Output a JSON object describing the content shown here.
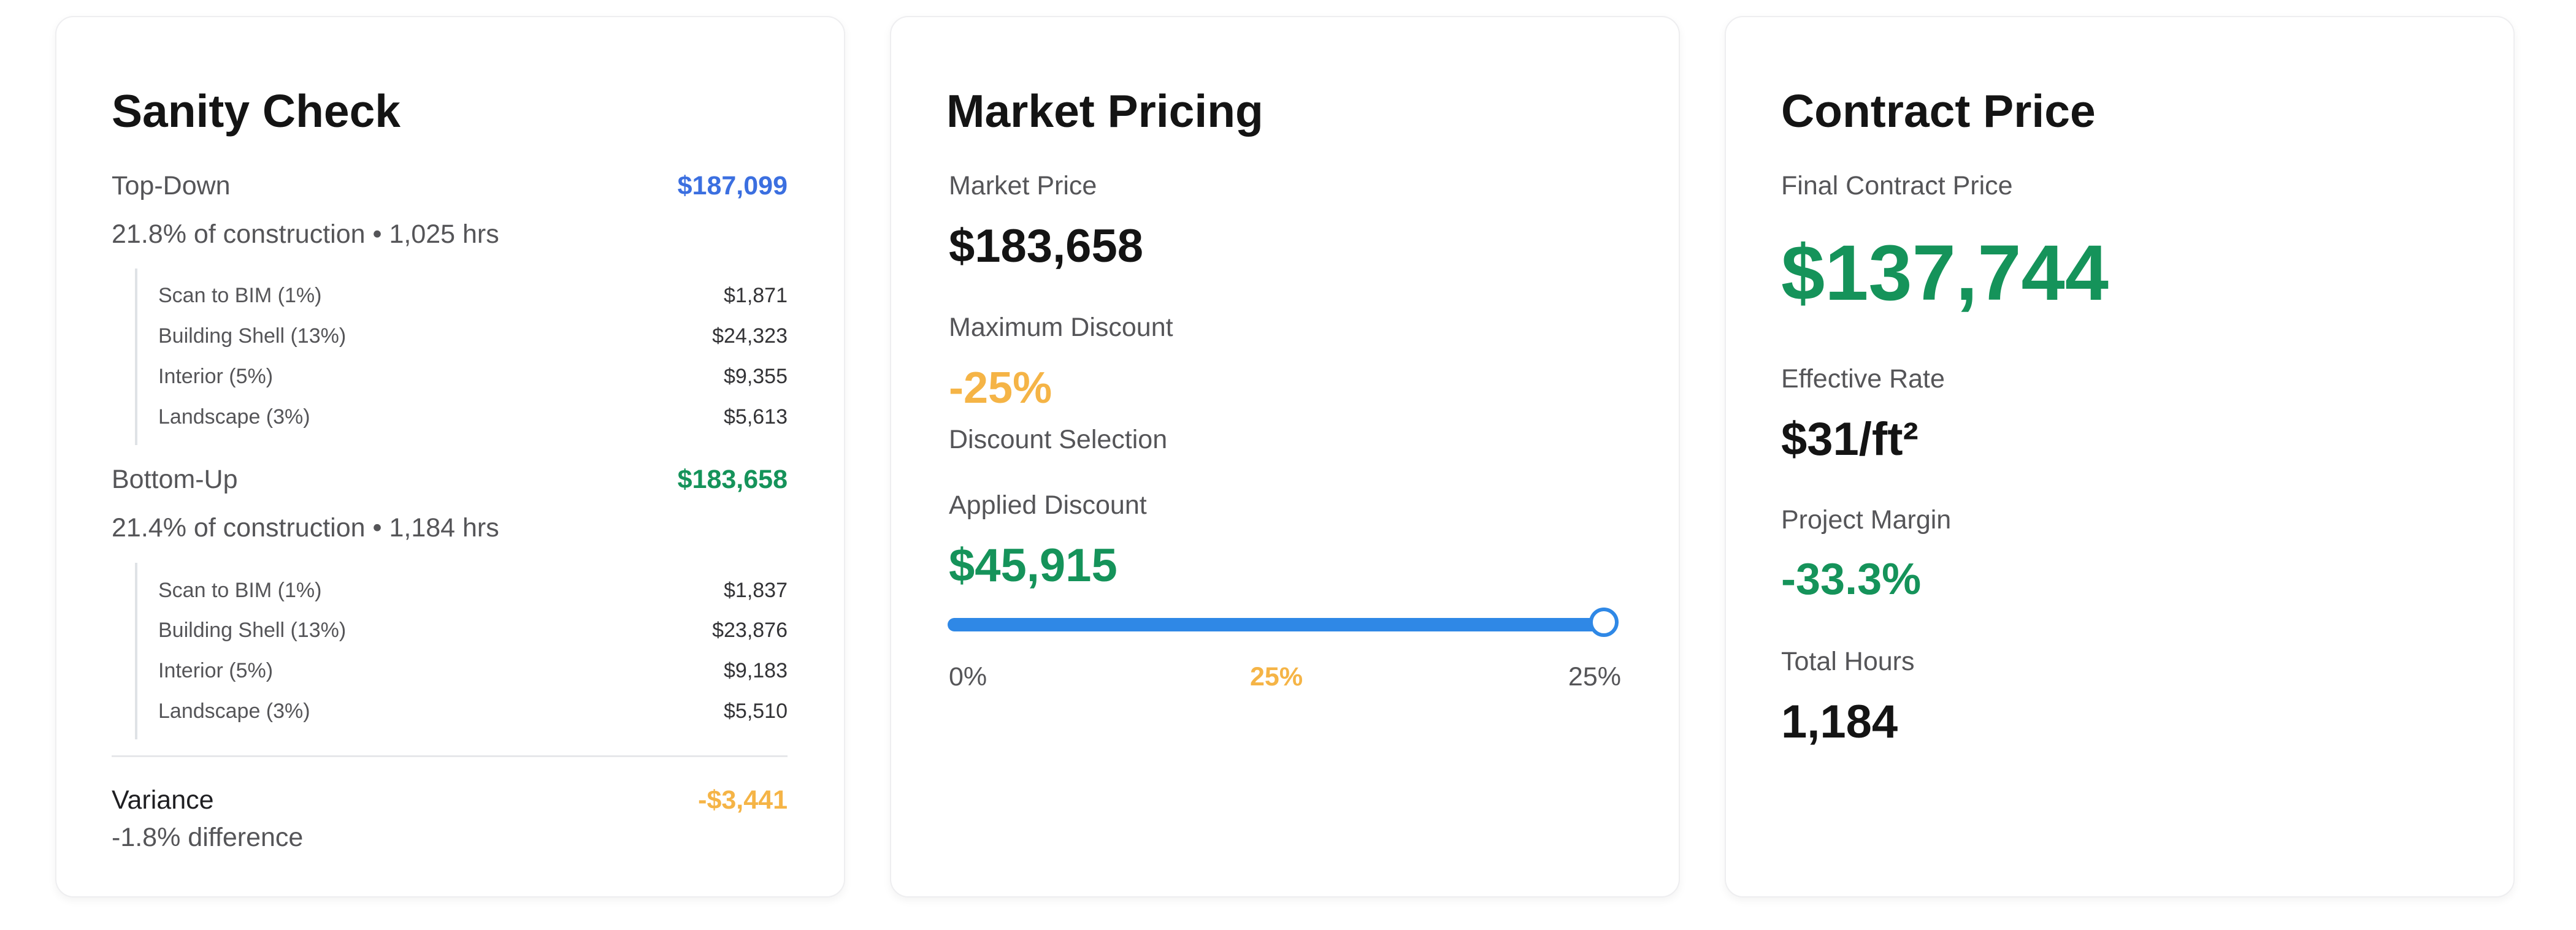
{
  "sanity": {
    "title": "Sanity Check",
    "topdown": {
      "label": "Top-Down",
      "amount": "$187,099",
      "detail": "21.8% of construction • 1,025 hrs",
      "items": [
        {
          "name": "Scan to BIM (1%)",
          "value": "$1,871"
        },
        {
          "name": "Building Shell (13%)",
          "value": "$24,323"
        },
        {
          "name": "Interior (5%)",
          "value": "$9,355"
        },
        {
          "name": "Landscape (3%)",
          "value": "$5,613"
        }
      ]
    },
    "bottomup": {
      "label": "Bottom-Up",
      "amount": "$183,658",
      "detail": "21.4% of construction • 1,184 hrs",
      "items": [
        {
          "name": "Scan to BIM (1%)",
          "value": "$1,837"
        },
        {
          "name": "Building Shell (13%)",
          "value": "$23,876"
        },
        {
          "name": "Interior (5%)",
          "value": "$9,183"
        },
        {
          "name": "Landscape (3%)",
          "value": "$5,510"
        }
      ]
    },
    "variance": {
      "label": "Variance",
      "amount": "-$3,441",
      "detail": "-1.8% difference"
    }
  },
  "market": {
    "title": "Market Pricing",
    "price_label": "Market Price",
    "price": "$183,658",
    "max_discount_label": "Maximum Discount",
    "max_discount": "-25%",
    "selection_label": "Discount Selection",
    "applied_label": "Applied Discount",
    "applied": "$45,915",
    "slider": {
      "min_label": "0%",
      "current_label": "25%",
      "max_label": "25%",
      "value_fraction": 1.0
    }
  },
  "contract": {
    "title": "Contract Price",
    "final_label": "Final Contract Price",
    "final": "$137,744",
    "rate_label": "Effective Rate",
    "rate": "$31/ft²",
    "margin_label": "Project Margin",
    "margin": "-33.3%",
    "hours_label": "Total Hours",
    "hours": "1,184"
  },
  "colors": {
    "blue": "#3b6fe0",
    "green": "#15935a",
    "orange": "#f5b446",
    "slider": "#2f88e6"
  }
}
